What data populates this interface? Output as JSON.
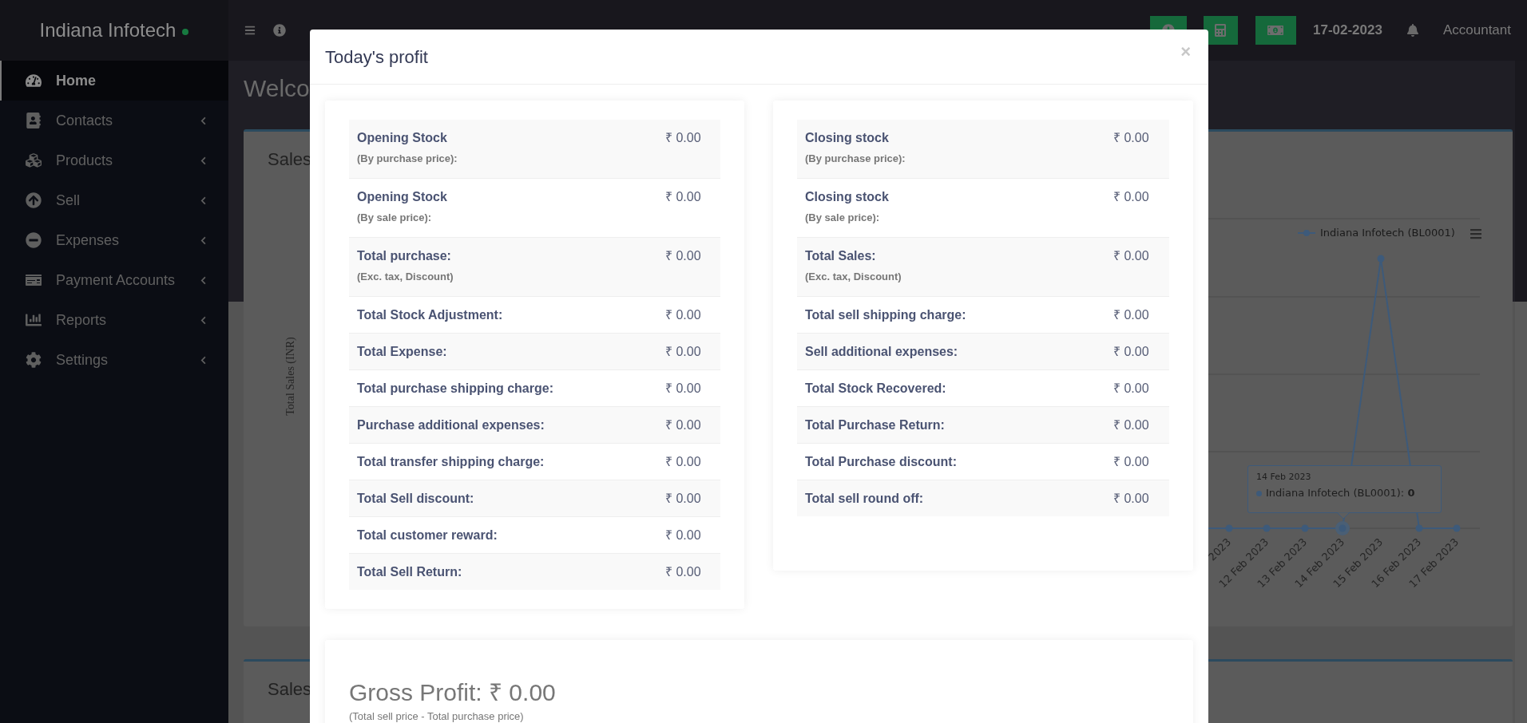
{
  "topbar": {
    "brand": "Indiana Infotech",
    "online": true,
    "date": "17-02-2023",
    "user": "Accountant"
  },
  "sidebar": {
    "items": [
      {
        "label": "Home",
        "selected": true,
        "has_submenu": false
      },
      {
        "label": "Contacts",
        "selected": false,
        "has_submenu": true
      },
      {
        "label": "Products",
        "selected": false,
        "has_submenu": true
      },
      {
        "label": "Sell",
        "selected": false,
        "has_submenu": true
      },
      {
        "label": "Expenses",
        "selected": false,
        "has_submenu": true
      },
      {
        "label": "Payment Accounts",
        "selected": false,
        "has_submenu": true
      },
      {
        "label": "Reports",
        "selected": false,
        "has_submenu": true
      },
      {
        "label": "Settings",
        "selected": false,
        "has_submenu": true
      }
    ]
  },
  "page": {
    "heading": "Welco",
    "sales_card": {
      "title": "Sales",
      "yaxis_title": "Total Sales (INR)",
      "legend": "Indiana Infotech (BL0001)",
      "x_labels": [
        "2023",
        "12 Feb 2023",
        "13 Feb 2023",
        "14 Feb 2023",
        "15 Feb 2023",
        "16 Feb 2023",
        "17 Feb 2023"
      ],
      "tooltip": {
        "date": "14 Feb 2023",
        "text": "Indiana Infotech (BL0001): **0**"
      }
    },
    "second_card": {
      "title": "Sales"
    }
  },
  "modal": {
    "title": "Today's profit",
    "close": "×",
    "left_rows": [
      {
        "label": "Opening Stock",
        "note": "(By purchase price):",
        "value": "₹ 0.00"
      },
      {
        "label": "Opening Stock",
        "note": "(By sale price):",
        "value": "₹ 0.00"
      },
      {
        "label": "Total purchase:",
        "note": "(Exc. tax, Discount)",
        "value": "₹ 0.00"
      },
      {
        "label": "Total Stock Adjustment:",
        "value": "₹ 0.00"
      },
      {
        "label": "Total Expense:",
        "value": "₹ 0.00"
      },
      {
        "label": "Total purchase shipping charge:",
        "value": "₹ 0.00"
      },
      {
        "label": "Purchase additional expenses:",
        "value": "₹ 0.00"
      },
      {
        "label": "Total transfer shipping charge:",
        "value": "₹ 0.00"
      },
      {
        "label": "Total Sell discount:",
        "value": "₹ 0.00"
      },
      {
        "label": "Total customer reward:",
        "value": "₹ 0.00"
      },
      {
        "label": "Total Sell Return:",
        "value": "₹ 0.00"
      }
    ],
    "right_rows": [
      {
        "label": "Closing stock",
        "note": "(By purchase price):",
        "value": "₹ 0.00"
      },
      {
        "label": "Closing stock",
        "note": "(By sale price):",
        "value": "₹ 0.00"
      },
      {
        "label": "Total Sales:",
        "note": "(Exc. tax, Discount)",
        "value": "₹ 0.00"
      },
      {
        "label": "Total sell shipping charge:",
        "value": "₹ 0.00"
      },
      {
        "label": "Sell additional expenses:",
        "value": "₹ 0.00"
      },
      {
        "label": "Total Stock Recovered:",
        "value": "₹ 0.00"
      },
      {
        "label": "Total Purchase Return:",
        "value": "₹ 0.00"
      },
      {
        "label": "Total Purchase discount:",
        "value": "₹ 0.00"
      },
      {
        "label": "Total sell round off:",
        "value": "₹ 0.00"
      }
    ],
    "gross_profit": {
      "text": "Gross Profit: ₹ 0.00",
      "note": "(Total sell price - Total purchase price)"
    }
  }
}
